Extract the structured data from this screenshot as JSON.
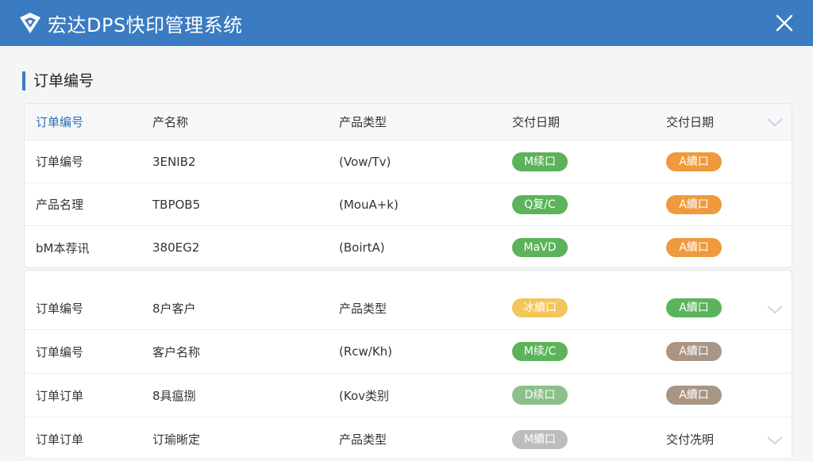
{
  "app": {
    "title": "宏达DPS快印管理系统"
  },
  "section": {
    "title": "订单编号"
  },
  "colors": {
    "titlebar": "#3a7bc1",
    "green": "#5bb35b",
    "orange": "#ee9a3d",
    "yellow": "#f3c55a",
    "brown": "#a89585",
    "lightgreen": "#8cc08a",
    "gray": "#bdbdbd"
  },
  "panel_a": {
    "header": [
      "订单编号",
      "产名称",
      "产品类型",
      "交付日期",
      "交付日期"
    ],
    "rows": [
      {
        "c1": "订单编号",
        "c2": "3ENIB2",
        "c3": "(Vow/Tv)",
        "p1": {
          "text": "M续口",
          "color": "green"
        },
        "p2": {
          "text": "A續口",
          "color": "orange"
        }
      },
      {
        "c1": "产品名理",
        "c2": "TBPOB5",
        "c3": "(MouA+k)",
        "p1": {
          "text": "Q复/C",
          "color": "green"
        },
        "p2": {
          "text": "A續口",
          "color": "orange"
        }
      },
      {
        "c1": "bM本荐讯",
        "c2": "380EG2",
        "c3": "(BoirtA)",
        "p1": {
          "text": "MaVD",
          "color": "green"
        },
        "p2": {
          "text": "A續口",
          "color": "orange"
        }
      }
    ]
  },
  "panel_b": {
    "rows": [
      {
        "c1": "订单编号",
        "c2": "8户客户",
        "c3": "产品类型",
        "p1": {
          "text": "冰續口",
          "color": "yellow"
        },
        "p2": {
          "text": "A續口",
          "color": "green"
        },
        "chevron": true
      },
      {
        "c1": "订单编号",
        "c2": "客户名称",
        "c3": "(Rcw/Kh)",
        "p1": {
          "text": "M续/C",
          "color": "green"
        },
        "p2": {
          "text": "A續口",
          "color": "brown"
        }
      },
      {
        "c1": "订单订单",
        "c2": "8具瘟捌",
        "c3": "(Kov类别",
        "p1": {
          "text": "D续口",
          "color": "lightgreen"
        },
        "p2": {
          "text": "A續口",
          "color": "brown"
        }
      },
      {
        "c1": "订单订单",
        "c2": "订瑜晰定",
        "c3": "产品类型",
        "p1": {
          "text": "M續口",
          "color": "gray"
        },
        "p2text": "交付冼明",
        "chevron": true
      }
    ]
  }
}
